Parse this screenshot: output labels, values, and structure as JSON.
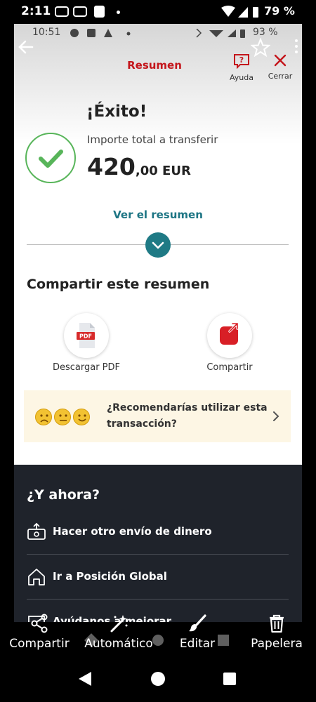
{
  "outer_status": {
    "time": "2:11",
    "battery": "79 %"
  },
  "inner_status": {
    "time": "10:51",
    "battery": "93 %"
  },
  "header": {
    "title": "Resumen",
    "help_label": "Ayuda",
    "close_label": "Cerrar"
  },
  "success": {
    "heading": "¡Éxito!",
    "amount_label": "Importe total a transferir",
    "amount_int": "420",
    "amount_dec": ",00 EUR"
  },
  "summary_link": "Ver el resumen",
  "share": {
    "title": "Compartir este resumen",
    "pdf_label": "Descargar PDF",
    "pdf_icon_text": "PDF",
    "share_label": "Compartir"
  },
  "feedback": {
    "question": "¿Recomendarías utilizar esta transacción?"
  },
  "next": {
    "title": "¿Y ahora?",
    "items": [
      {
        "label": "Hacer otro envío de dinero"
      },
      {
        "label": "Ir a Posición Global"
      },
      {
        "label": "Ayúdanos a mejorar"
      }
    ]
  },
  "toolbar": {
    "share": "Compartir",
    "auto": "Automático",
    "edit": "Editar",
    "trash": "Papelera"
  },
  "colors": {
    "brand_red": "#c4161c",
    "teal": "#1f7a85",
    "success_green": "#58b55a",
    "dark_bg": "#1f232b"
  }
}
